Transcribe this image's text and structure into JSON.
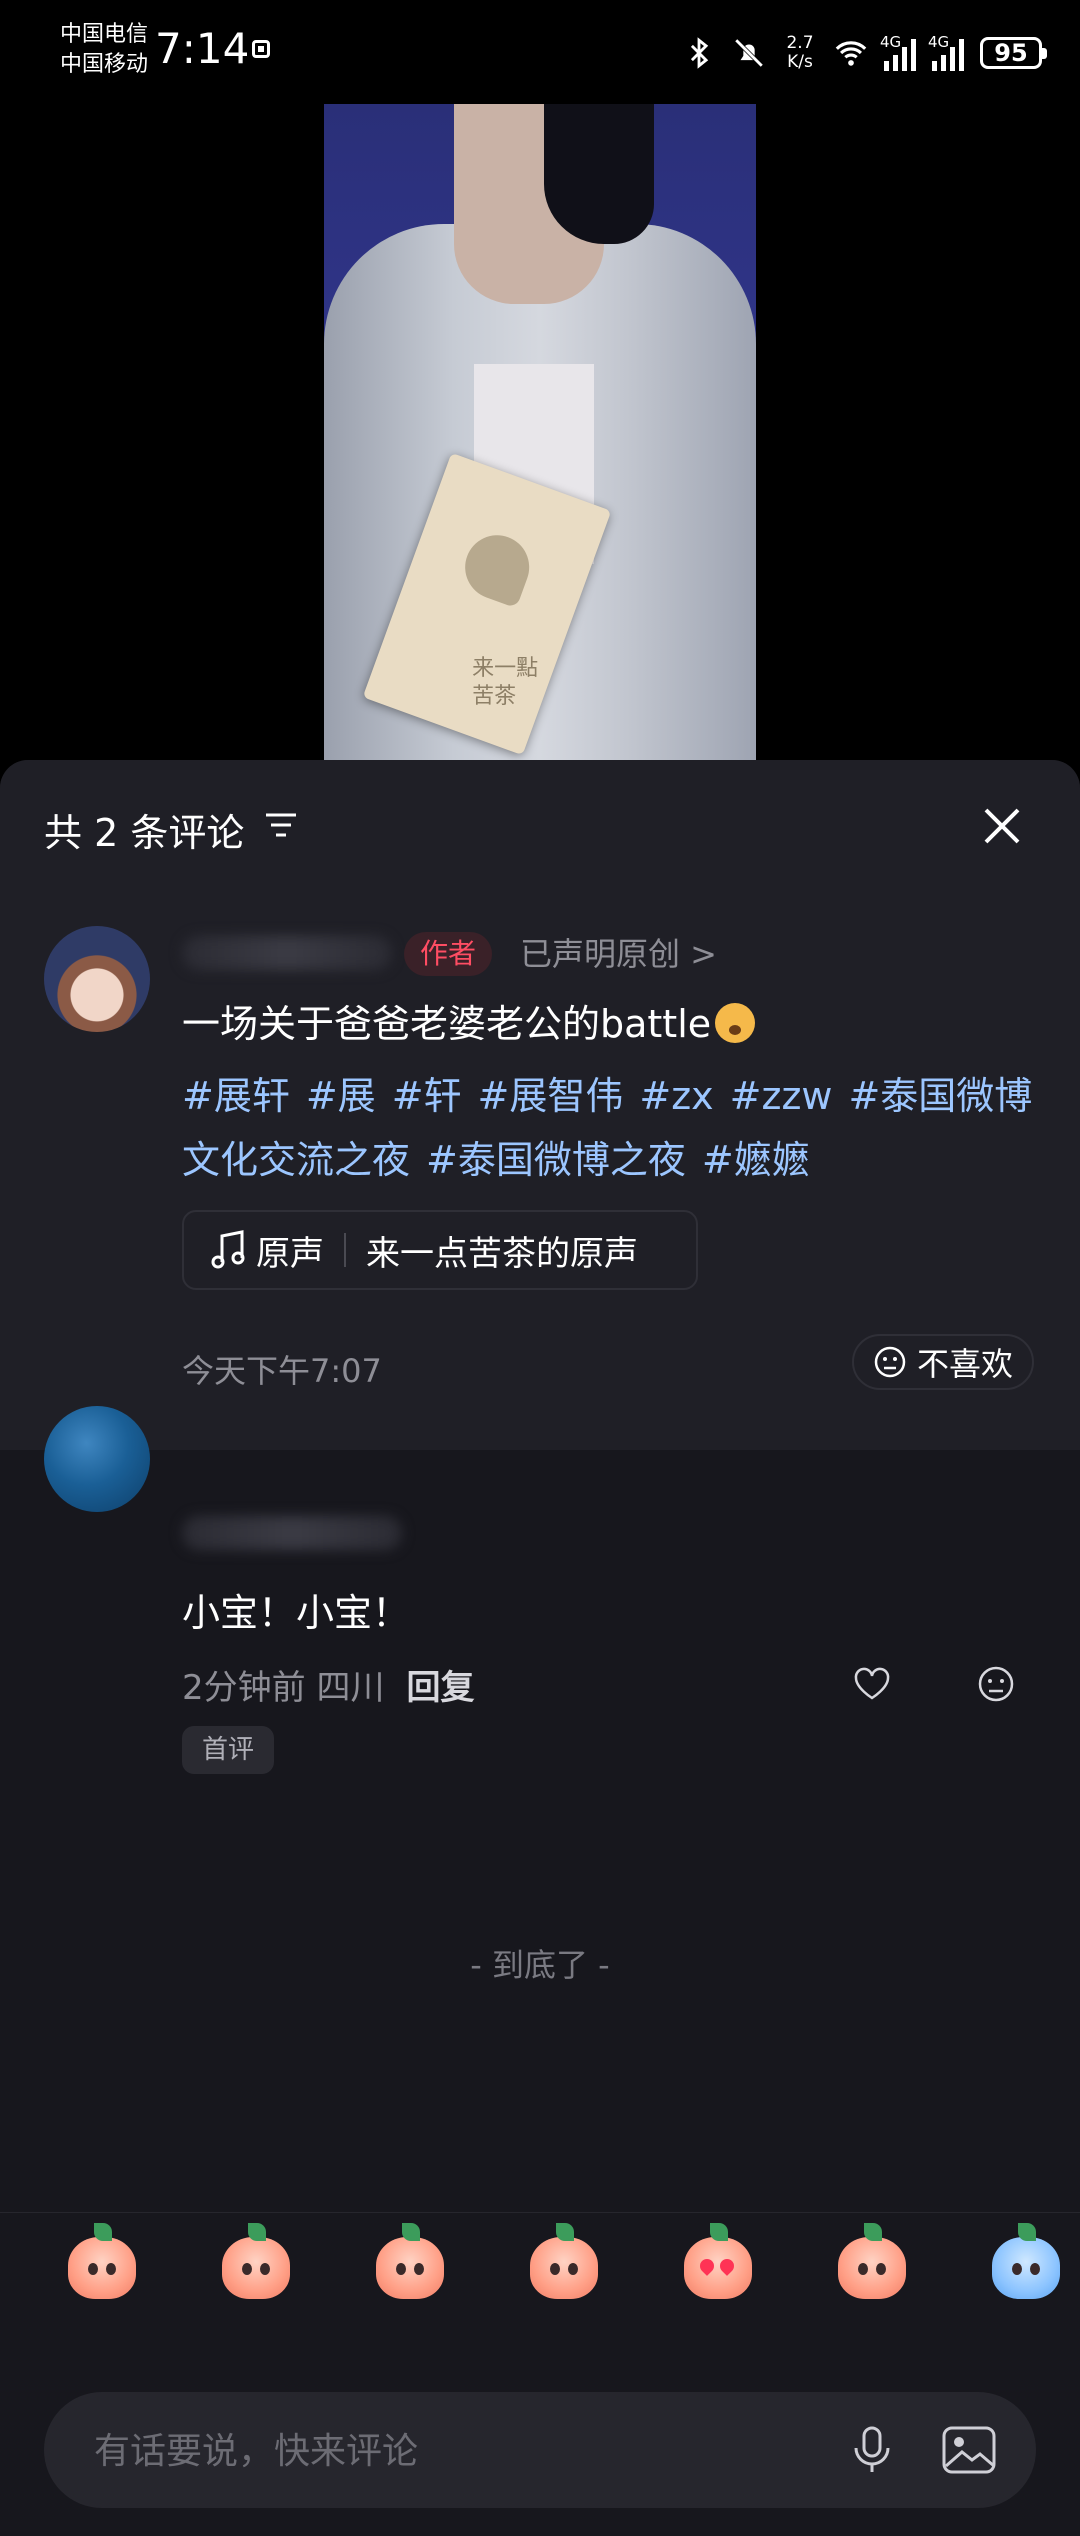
{
  "status_bar": {
    "carrier_1": "中国电信",
    "carrier_2": "中国移动",
    "time": "7:14",
    "net_speed_value": "2.7",
    "net_speed_unit": "K/s",
    "sig1_label": "4G",
    "sig2_label": "4G",
    "battery": "95"
  },
  "video": {
    "watermark_line1": "来一點",
    "watermark_line2": "苦茶"
  },
  "comments_panel": {
    "title": "共 2 条评论",
    "post": {
      "author_tag": "作者",
      "declared_original": "已声明原创 >",
      "title": "一场关于爸爸老婆老公的battle",
      "hashtags": [
        "#展轩",
        "#展",
        "#轩",
        "#展智伟",
        "#zx",
        "#zzw",
        "#泰国微博文化交流之夜",
        "#泰国微博之夜",
        "#嬷嬷"
      ],
      "music_label": "原声",
      "music_name": "来一点苦茶的原声",
      "time": "今天下午7:07",
      "dislike_label": "不喜欢"
    },
    "comment": {
      "text": "小宝！小宝！",
      "time_location": "2分钟前 四川",
      "reply_label": "回复",
      "first_tag": "首评"
    },
    "end_text": "- 到底了 -",
    "input": {
      "placeholder": "有话要说，快来评论"
    }
  },
  "icons": {
    "filter": "filter-icon",
    "close": "close-icon",
    "music": "music-note-icon",
    "dislike": "neutral-face-icon",
    "like": "heart-icon",
    "mic": "microphone-icon",
    "image": "image-icon"
  },
  "colors": {
    "panel_bg": "#17171d",
    "card_bg": "#1f1f26",
    "hashtag": "#9cc6ff",
    "author_tag": "#ff4d63"
  }
}
